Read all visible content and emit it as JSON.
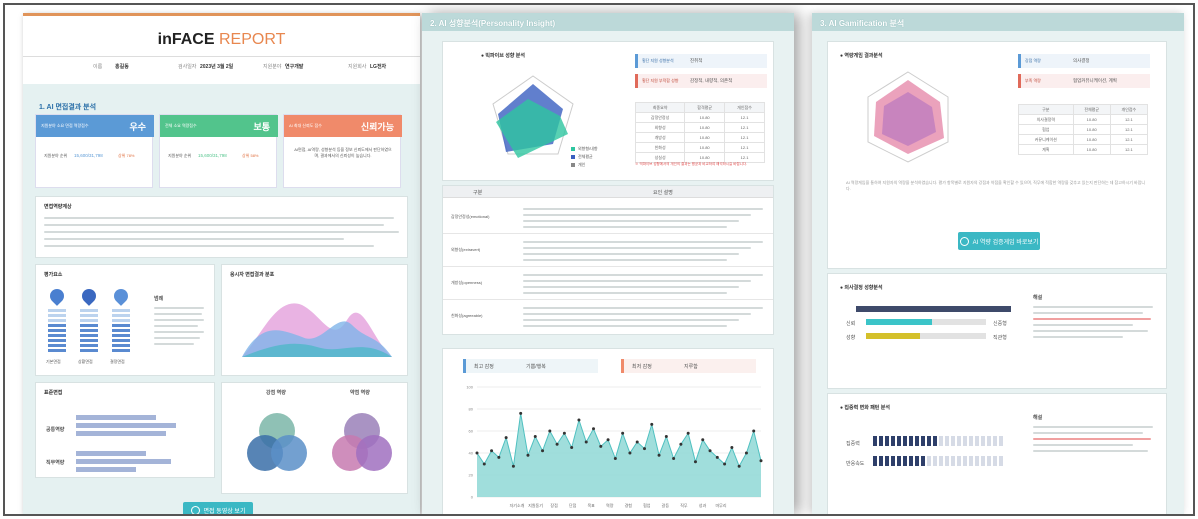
{
  "report": {
    "brand_prefix": "inFACE",
    "brand_suffix": " REPORT",
    "info_labels": [
      "이름",
      "검사일자",
      "지원분야",
      "지원회사"
    ],
    "info_values": [
      "홍길동",
      "2023년 3월 2일",
      "연구개발",
      "LG전자"
    ],
    "section1_title": "1. AI 면접결과 분석",
    "score_cards": [
      {
        "label": "지원분야 소요 면접 역량점수",
        "grade": "우수",
        "color": "#5b9ad6",
        "sub_label": "지원분야 순위",
        "sub_value": "15,600/31,798",
        "sub_extra": "상위 78%"
      },
      {
        "label": "전체 소요 역량점수",
        "grade": "보통",
        "color": "#52c48c",
        "sub_label": "지원분야 순위",
        "sub_value": "15,600/31,798",
        "sub_extra": "상위 58%"
      },
      {
        "label": "AI 최대 신뢰도 점수",
        "grade": "신뢰가능",
        "color": "#f08a6a",
        "sub_label": "",
        "sub_value": "",
        "sub_extra": ""
      }
    ],
    "trust_note": "AI면접, AI역량, 성향분석 등을 정보 신뢰도에서 판단하였으며, 결과에서의 신뢰성이 높습니다.",
    "overall_title": "면접역량계상",
    "section_chart1": "평가요소",
    "section_chart2": "응시자 면접결과 분포",
    "gauge_labels": [
      "기본면접",
      "상황면접",
      "결정면접"
    ],
    "legend_title": "범례",
    "bottom_titles": [
      "표준면접",
      "강점 역량",
      "약점 역량"
    ],
    "bottom_rows": [
      "공통역량",
      "직무역량"
    ],
    "bottom_btn": "면접 동영상 보기"
  },
  "personality": {
    "title": "2. AI 성향분석(Personality Insight)",
    "radar_title": "● 빅파이브 성향 분석",
    "legend": [
      "외향형/내향",
      "전체평균",
      "개인"
    ],
    "type_labels": [
      "횡단 지원 성향분석",
      "횡단 지원 부적합 성향"
    ],
    "type_values": [
      "진취적",
      "감정적, 내향적, 의존적"
    ],
    "table_headers": [
      "최종요약",
      "합격평균",
      "개인점수"
    ],
    "table_rows": [
      [
        "감정안정성",
        "10.80",
        "12.1"
      ],
      [
        "외향성",
        "10.80",
        "12.1"
      ],
      [
        "개방성",
        "10.80",
        "12.1"
      ],
      [
        "친화성",
        "10.80",
        "12.1"
      ],
      [
        "성실성",
        "10.80",
        "12.1"
      ]
    ],
    "note": "※ 빅파이브 성향에서의 개인의 결과는 평균과 비교하여 해석하시길 바랍니다.",
    "desc_headers": [
      "구분",
      "요인 설명"
    ],
    "desc_rows": [
      "감정안정성(emotional)",
      "외향성(extravert)",
      "개방성(openness)",
      "친화성(agreeable)"
    ],
    "emotion_labels": [
      "최고 감정",
      "최저 감정"
    ],
    "emotion_values": [
      "기쁨/행복",
      "지루함"
    ]
  },
  "chart_data": {
    "type": "area",
    "title": "",
    "xlabel": "",
    "ylabel": "",
    "ylim": [
      0,
      100
    ],
    "yticks": [
      0,
      20,
      40,
      60,
      80,
      100
    ],
    "categories": [
      "자기소개",
      "지원동기",
      "장점",
      "단점",
      "목표",
      "역량",
      "경험",
      "협업",
      "갈등",
      "직무",
      "성과",
      "마무리"
    ],
    "values": [
      40,
      30,
      42,
      36,
      54,
      28,
      76,
      38,
      55,
      42,
      60,
      48,
      58,
      45,
      70,
      50,
      62,
      46,
      52,
      35,
      58,
      40,
      50,
      44,
      66,
      38,
      55,
      35,
      48,
      58,
      32,
      52,
      42,
      36,
      30,
      45,
      28,
      40,
      60,
      33
    ],
    "series": [
      {
        "name": "",
        "values": [
          40,
          30,
          42,
          36,
          54,
          28,
          76,
          38,
          55,
          42,
          60,
          48,
          58,
          45,
          70,
          50,
          62,
          46,
          52,
          35,
          58,
          40,
          50,
          44,
          66,
          38,
          55,
          35,
          48,
          58,
          32,
          52,
          42,
          36,
          30,
          45,
          28,
          40,
          60,
          33
        ]
      }
    ],
    "grid": true
  },
  "gamification": {
    "title": "3. AI Gamification 분석",
    "radar_title": "● 역량게임 결과분석",
    "type_labels": [
      "강점 역량",
      "부족 역량"
    ],
    "type_values": [
      "의사결정",
      "협업커뮤니케이션, 계획"
    ],
    "table_headers": [
      "구분",
      "전체평균",
      "개인점수"
    ],
    "table_rows": [
      [
        "의사결정력",
        "10.80",
        "12.1"
      ],
      [
        "협업",
        "10.80",
        "12.1"
      ],
      [
        "커뮤니케이션",
        "10.80",
        "12.1"
      ],
      [
        "계획",
        "10.80",
        "12.1"
      ]
    ],
    "summary": "AI 역량게임을 통하여 지원자의 역량을 분석하였습니다. 평가 항목별로 지원자의 강점과 약점을 확인할 수 있으며, 직무에 적합한 역량을 갖추고 있는지 판단하는 데 참고하시기 바랍니다.",
    "button": "AI 역량 검증게임 바로보기",
    "section2": "● 의사결정 성향분석",
    "bar_labels": [
      "신뢰",
      "성향"
    ],
    "bar_ends": [
      "신중형",
      "직관형"
    ],
    "section3": "● 집중력 변화 패턴 분석",
    "pattern_labels": [
      "집중력",
      "반응속도"
    ],
    "desc_title": "해설"
  }
}
